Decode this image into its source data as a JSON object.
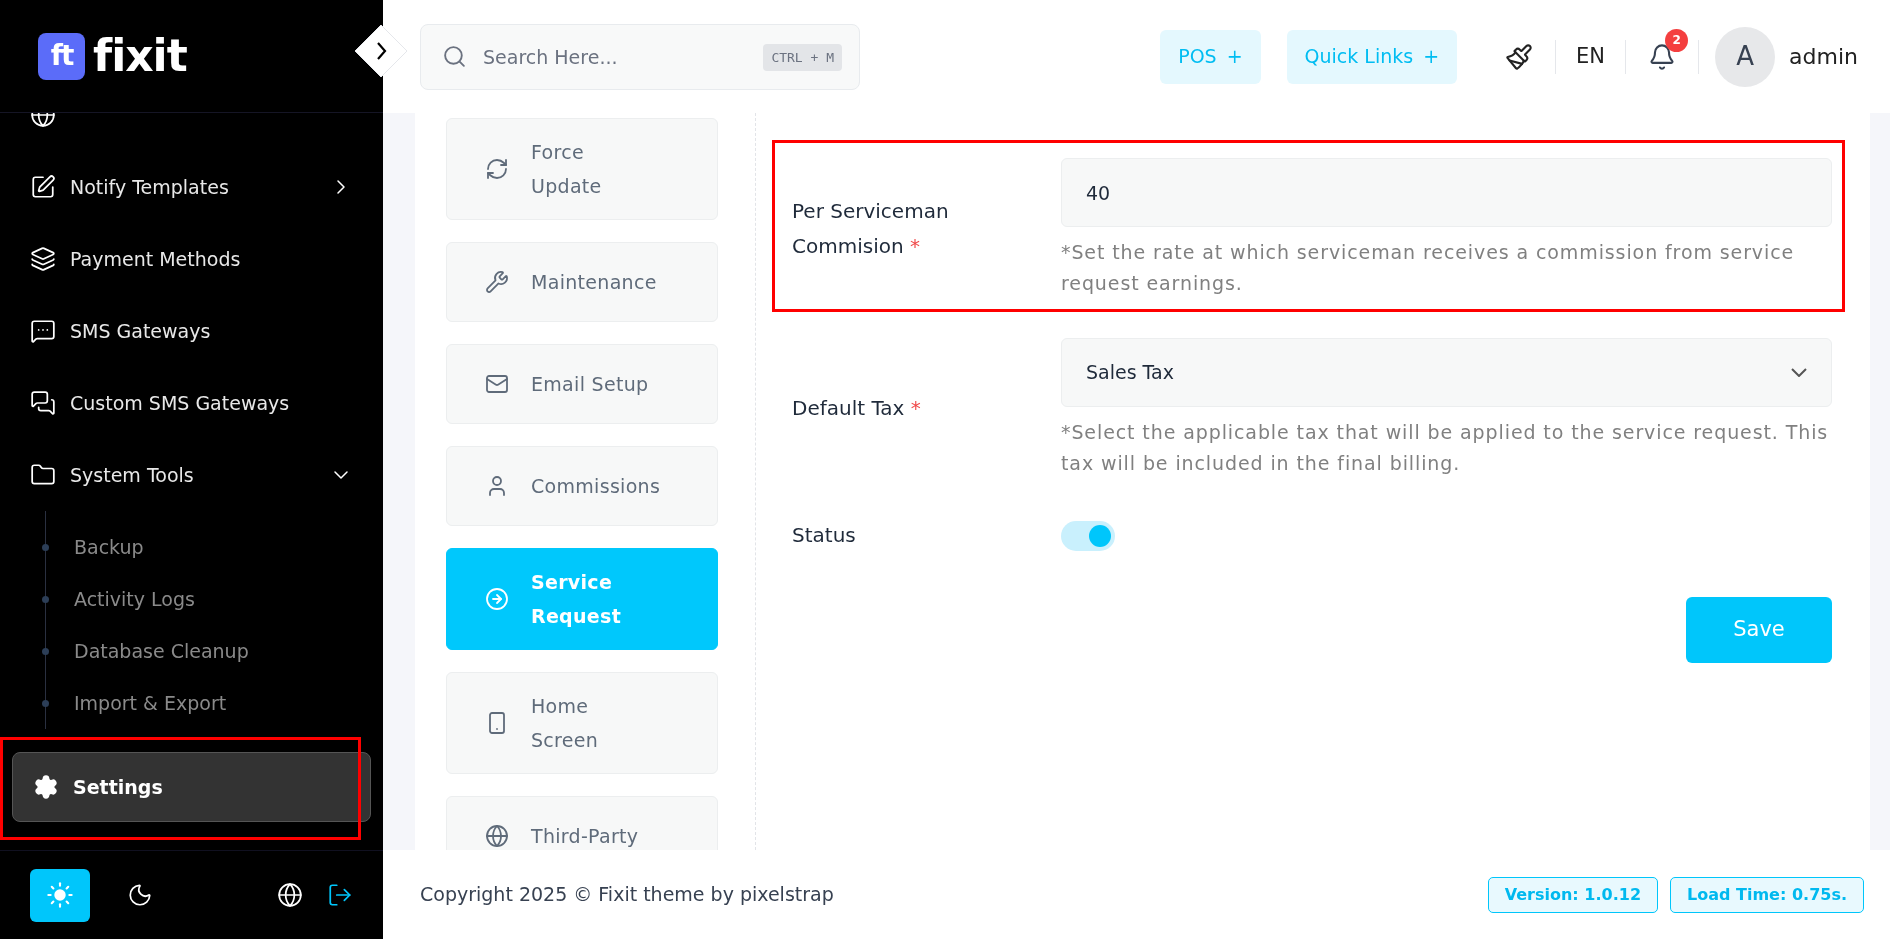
{
  "brand": {
    "mark": "ft",
    "name": "fixit"
  },
  "sidebar": {
    "items": [
      {
        "label": "Notify Templates",
        "kind": "group",
        "selected": false,
        "expanded": false
      },
      {
        "label": "Payment Methods",
        "kind": "link",
        "selected": false
      },
      {
        "label": "SMS Gateways",
        "kind": "link",
        "selected": false
      },
      {
        "label": "Custom SMS Gateways",
        "kind": "link",
        "selected": false
      },
      {
        "label": "System Tools",
        "kind": "group",
        "selected": false,
        "expanded": true,
        "children": [
          {
            "label": "Backup",
            "selected": false
          },
          {
            "label": "Activity Logs",
            "selected": false
          },
          {
            "label": "Database Cleanup",
            "selected": false
          },
          {
            "label": "Import & Export",
            "selected": false
          }
        ]
      },
      {
        "label": "Settings",
        "kind": "link",
        "selected": true
      }
    ],
    "themes": [
      {
        "kind": "light",
        "selected": true
      },
      {
        "kind": "dark",
        "selected": false
      }
    ]
  },
  "header": {
    "search": {
      "placeholder": "Search Here...",
      "shortcut": "CTRL + M"
    },
    "buttons": [
      {
        "label": "POS",
        "suffix": "+"
      },
      {
        "label": "Quick Links",
        "suffix": "+"
      }
    ],
    "language": "EN",
    "notifications": "2",
    "user": {
      "initial": "A",
      "name": "admin"
    }
  },
  "tabs": [
    {
      "label": "Force\nUpdate",
      "selected": false
    },
    {
      "label": "Maintenance",
      "selected": false
    },
    {
      "label": "Email Setup",
      "selected": false
    },
    {
      "label": "Commissions",
      "selected": false
    },
    {
      "label": "Service\nRequest",
      "selected": true
    },
    {
      "label": "Home\nScreen",
      "selected": false
    },
    {
      "label": "Third-Party",
      "selected": false
    }
  ],
  "form": {
    "fields": [
      {
        "kind": "text",
        "label": "Per Serviceman Commision",
        "required_mark": "*",
        "value": "40",
        "hint": "*Set the rate at which serviceman receives a commission from service request earnings.",
        "highlighted": true
      },
      {
        "kind": "select",
        "label": "Default Tax",
        "required_mark": "*",
        "value": "Sales Tax",
        "hint": "*Select the applicable tax that will be applied to the service request. This tax will be included in the final billing.",
        "highlighted": false
      },
      {
        "kind": "toggle",
        "label": "Status",
        "on": true
      }
    ],
    "save": "Save"
  },
  "footer": {
    "copyright": "Copyright 2025 © Fixit theme by pixelstrap",
    "version": "Version: 1.0.12",
    "load_time": "Load Time: 0.75s."
  }
}
